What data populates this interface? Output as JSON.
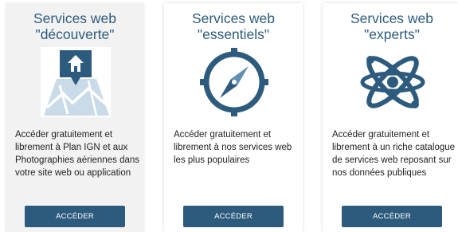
{
  "colors": {
    "primary": "#2d5b7d",
    "card_background": "#f2f2f2"
  },
  "cards": [
    {
      "title_line1": "Services web",
      "title_line2": "\"découverte\"",
      "icon": "map-home-icon",
      "desc": [
        "Accéder gratuitement et",
        "librement à Plan IGN et aux",
        "Photographies aériennes dans",
        "votre site web ou application"
      ],
      "button": "ACCÉDER"
    },
    {
      "title_line1": "Services web",
      "title_line2": "\"essentiels\"",
      "icon": "compass-icon",
      "desc": [
        "Accéder gratuitement et",
        "librement à nos services web",
        "les plus populaires"
      ],
      "button": "ACCÉDER"
    },
    {
      "title_line1": "Services web",
      "title_line2": "\"experts\"",
      "icon": "atom-icon",
      "desc": [
        "Accéder gratuitement et",
        "librement à un riche catalogue",
        "de services web reposant sur",
        "nos données publiques"
      ],
      "button": "ACCÉDER"
    }
  ]
}
